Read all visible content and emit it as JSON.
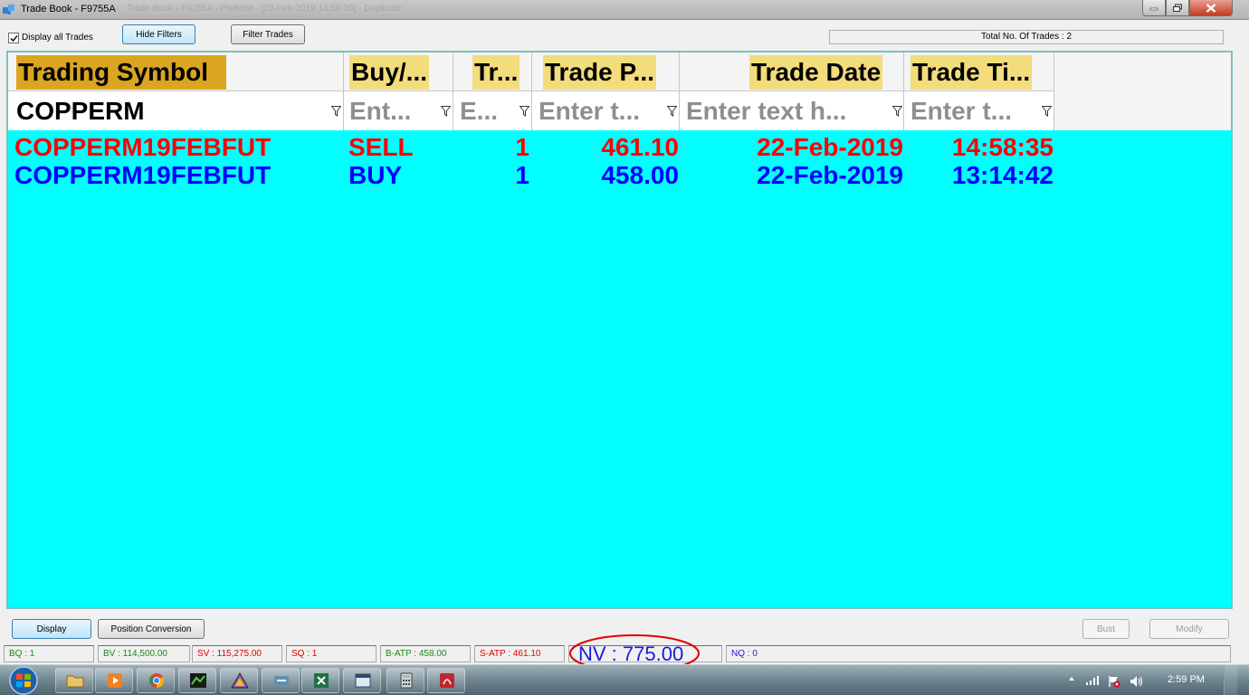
{
  "window": {
    "title": "Trade Book - F9755A",
    "title_ghost": "Trade Book - F9755A - ProNext - [22-Feb-2019 14:59:00] - Duplicate"
  },
  "toolbar": {
    "display_all_label": "Display all Trades",
    "display_all_checked": true,
    "hide_filters_label": "Hide Filters",
    "filter_trades_label": "Filter Trades",
    "total_trades": "Total No. Of Trades : 2"
  },
  "grid": {
    "background_color": "#00ffff",
    "columns": [
      {
        "key": "symbol",
        "header": "Trading Symbol",
        "filter_value": "COPPERM",
        "filter_placeholder": ""
      },
      {
        "key": "buysell",
        "header": "Buy/...",
        "filter_value": "",
        "filter_placeholder": "Ent..."
      },
      {
        "key": "qty",
        "header": "Tr...",
        "filter_value": "",
        "filter_placeholder": "E..."
      },
      {
        "key": "price",
        "header": "Trade P...",
        "filter_value": "",
        "filter_placeholder": "Enter t..."
      },
      {
        "key": "date",
        "header": "Trade Date",
        "filter_value": "",
        "filter_placeholder": "Enter text h..."
      },
      {
        "key": "time",
        "header": "Trade Ti...",
        "filter_value": "",
        "filter_placeholder": "Enter t..."
      }
    ],
    "rows": [
      {
        "symbol": "COPPERM19FEBFUT",
        "buysell": "SELL",
        "qty": "1",
        "price": "461.10",
        "date": "22-Feb-2019",
        "time": "14:58:35",
        "color": "#ff0000"
      },
      {
        "symbol": "COPPERM19FEBFUT",
        "buysell": "BUY",
        "qty": "1",
        "price": "458.00",
        "date": "22-Feb-2019",
        "time": "13:14:42",
        "color": "#0000ff"
      }
    ]
  },
  "bottom_buttons": {
    "display": "Display",
    "position_conversion": "Position Conversion",
    "bust": "Bust",
    "modify": "Modify"
  },
  "status": {
    "bq": "BQ : 1",
    "bv": "BV : 114,500.00",
    "sv": "SV : 115,275.00",
    "sq": "SQ : 1",
    "batp": "B-ATP : 458.00",
    "satp": "S-ATP : 461.10",
    "nv": "NV : 775.00",
    "nq": "NQ : 0"
  },
  "taskbar": {
    "clock": "2:59 PM",
    "items": [
      "folder-icon",
      "media-player-icon",
      "chrome-icon",
      "chart-app-icon",
      "triangle-app-icon",
      "network-app-icon",
      "excel-icon",
      "window-app-icon",
      "calculator-icon",
      "pdf-icon"
    ]
  }
}
